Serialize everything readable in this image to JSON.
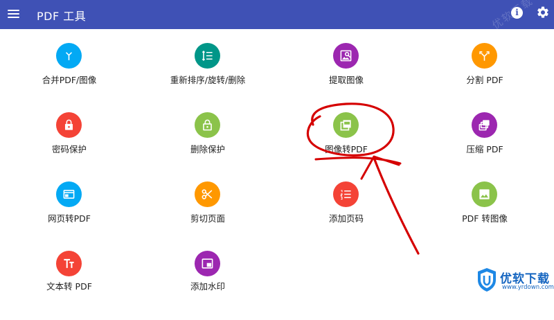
{
  "appbar": {
    "title": "PDF 工具",
    "menu_icon": "menu-icon",
    "info_icon": "info-icon",
    "info_glyph": "i",
    "settings_icon": "gear-icon",
    "background": "#3f51b5"
  },
  "tools": [
    {
      "label": "合并PDF/图像",
      "icon": "merge-icon",
      "color": "#03a9f4"
    },
    {
      "label": "重新排序/旋转/删除",
      "icon": "reorder-icon",
      "color": "#009688"
    },
    {
      "label": "提取图像",
      "icon": "extract-image-icon",
      "color": "#9c27b0"
    },
    {
      "label": "分割 PDF",
      "icon": "split-icon",
      "color": "#ff9800"
    },
    {
      "label": "密码保护",
      "icon": "lock-icon",
      "color": "#f44336"
    },
    {
      "label": "删除保护",
      "icon": "unlock-icon",
      "color": "#8bc34a"
    },
    {
      "label": "图像转PDF",
      "icon": "image-to-pdf-icon",
      "color": "#8bc34a"
    },
    {
      "label": "压缩 PDF",
      "icon": "compress-icon",
      "color": "#9c27b0"
    },
    {
      "label": "网页转PDF",
      "icon": "web-page-icon",
      "color": "#03a9f4"
    },
    {
      "label": "剪切页面",
      "icon": "scissors-icon",
      "color": "#ff9800"
    },
    {
      "label": "添加页码",
      "icon": "numbered-list-icon",
      "color": "#f44336"
    },
    {
      "label": "PDF 转图像",
      "icon": "image-icon",
      "color": "#8bc34a"
    },
    {
      "label": "文本转 PDF",
      "icon": "text-icon",
      "color": "#f44336"
    },
    {
      "label": "添加水印",
      "icon": "watermark-icon",
      "color": "#9c27b0"
    }
  ],
  "annotation": {
    "color": "#d50000"
  },
  "watermark": {
    "brand": "优软下载",
    "url": "www.yrdown.com",
    "corner_text": "优软下载",
    "color": "#1565c0"
  }
}
